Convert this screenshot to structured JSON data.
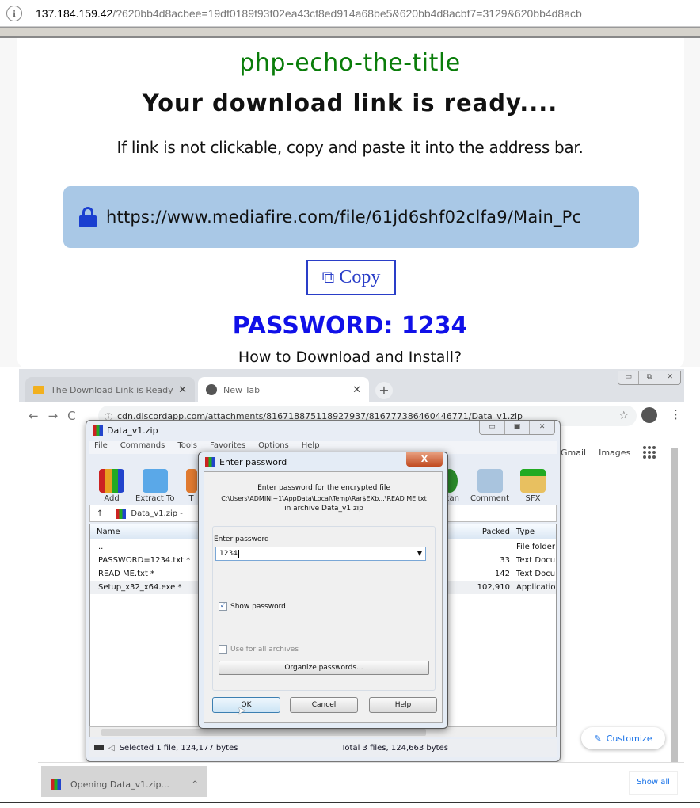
{
  "browser": {
    "address_host": "137.184.159.42",
    "address_query": "/?620bb4d8acbee=19df0189f93f02ea43cf8ed914a68be5&620bb4d8acbf7=3129&620bb4d8acb",
    "info_icon": "info-icon"
  },
  "page": {
    "site_title": "php-echo-the-title",
    "heading": "Your download link is ready....",
    "hint": "If link is not clickable, copy and paste it into the address bar.",
    "link_url": "https://www.mediafire.com/file/61jd6shf02clfa9/Main_Pc",
    "copy_label": "Copy",
    "password_label": "PASSWORD: 1234",
    "howto": "How to Download and Install?",
    "colors": {
      "title": "#0a7d0a",
      "password": "#1010e8",
      "linkbox": "#a9c8e6",
      "copy": "#2a3ec8"
    }
  },
  "screenshot": {
    "tabs": [
      {
        "label": "The Download Link is Ready",
        "icon": "folder-icon"
      },
      {
        "label": "New Tab",
        "icon": "globe-icon"
      }
    ],
    "newtab_label": "+",
    "window_controls": [
      "▭",
      "⧉",
      "✕"
    ],
    "nav": {
      "back": "←",
      "forward": "→",
      "reload": "C"
    },
    "omnibox_url": "cdn.discordapp.com/attachments/816718875118927937/816777386460446771/Data_v1.zip",
    "google_links": [
      "Gmail",
      "Images"
    ],
    "customize_label": "Customize",
    "winrar": {
      "title": "Data_v1.zip",
      "controls": [
        "▭",
        "▣",
        "✕"
      ],
      "menu": [
        "File",
        "Commands",
        "Tools",
        "Favorites",
        "Options",
        "Help"
      ],
      "tools": [
        {
          "label": "Add"
        },
        {
          "label": "Extract To"
        },
        {
          "label": "T"
        },
        {
          "label": "Scan"
        },
        {
          "label": "Comment"
        },
        {
          "label": "SFX"
        }
      ],
      "path": "Data_v1.zip -",
      "columns": {
        "name": "Name",
        "packed": "Packed",
        "type": "Type"
      },
      "rows": [
        {
          "name": "..",
          "packed": "",
          "type": "File folder"
        },
        {
          "name": "PASSWORD=1234.txt *",
          "packed": "33",
          "type": "Text Docu"
        },
        {
          "name": "READ ME.txt *",
          "packed": "142",
          "type": "Text Docu"
        },
        {
          "name": "Setup_x32_x64.exe *",
          "packed": "102,910",
          "type": "Applicatio"
        }
      ],
      "status_selected": "Selected 1 file, 124,177 bytes",
      "status_total": "Total 3 files, 124,663 bytes"
    },
    "password_dialog": {
      "title": "Enter password",
      "close": "X",
      "msg_line1": "Enter password for the encrypted file",
      "msg_line2": "C:\\Users\\ADMINI~1\\AppData\\Local\\Temp\\Rar$EXb...\\READ ME.txt",
      "msg_line3": "in archive Data_v1.zip",
      "field_label": "Enter password",
      "field_value": "1234",
      "show_password": "Show password",
      "show_password_checked": true,
      "use_all": "Use for all archives",
      "use_all_checked": false,
      "organize": "Organize passwords...",
      "ok": "OK",
      "cancel": "Cancel",
      "help": "Help"
    },
    "downloads": {
      "item": "Opening Data_v1.zip...",
      "caret": "^",
      "show_all": "Show all",
      "close": "✕"
    }
  }
}
